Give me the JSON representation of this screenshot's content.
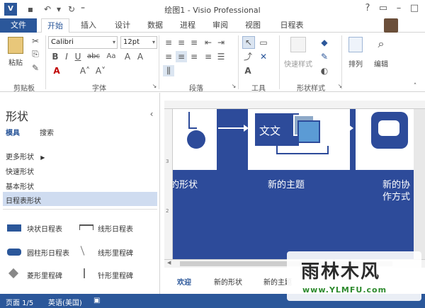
{
  "window": {
    "title": "绘图1 - Visio Professional",
    "app_icon": "V"
  },
  "tabs": {
    "file": "文件",
    "home": "开始",
    "insert": "插入",
    "design": "设计",
    "data": "数据",
    "process": "进程",
    "review": "审阅",
    "view": "视图",
    "schedule": "日程表"
  },
  "ribbon": {
    "paste": "粘贴",
    "clipboard_group": "剪贴板",
    "font_name": "Calibri",
    "font_size": "12pt",
    "font_group": "字体",
    "paragraph_group": "段落",
    "tools_group": "工具",
    "quick_styles": "快速样式",
    "shape_styles_group": "形状样式",
    "arrange": "排列",
    "edit": "编辑"
  },
  "left_pane": {
    "title": "形状",
    "tab_stencils": "模具",
    "tab_search": "搜索",
    "more_shapes": "更多形状",
    "quick_shapes": "快速形状",
    "basic_shapes": "基本形状",
    "timeline_shapes": "日程表形状",
    "shapes": [
      {
        "label": "块状日程表"
      },
      {
        "label": "线形日程表"
      },
      {
        "label": "圆柱形日程表"
      },
      {
        "label": "线形里程碑"
      },
      {
        "label": "菱形里程碑"
      },
      {
        "label": "针形里程碑"
      }
    ]
  },
  "canvas": {
    "box_text": "文文",
    "label_1": "的形状",
    "label_2": "新的主题",
    "label_3a": "新的协",
    "label_3b": "作方式",
    "ruler_marks": [
      "3",
      "2"
    ]
  },
  "page_tabs": [
    "欢迎",
    "新的形状",
    "新的主题"
  ],
  "status": {
    "page": "页面 1/5",
    "language": "英语(美国)"
  },
  "watermark": {
    "brand": "雨林木风",
    "url": "www.YLMFU.com"
  },
  "colors": {
    "accent": "#2b579a",
    "canvas_blue": "#2d4b9a",
    "box_blue": "#5b9bd5"
  }
}
